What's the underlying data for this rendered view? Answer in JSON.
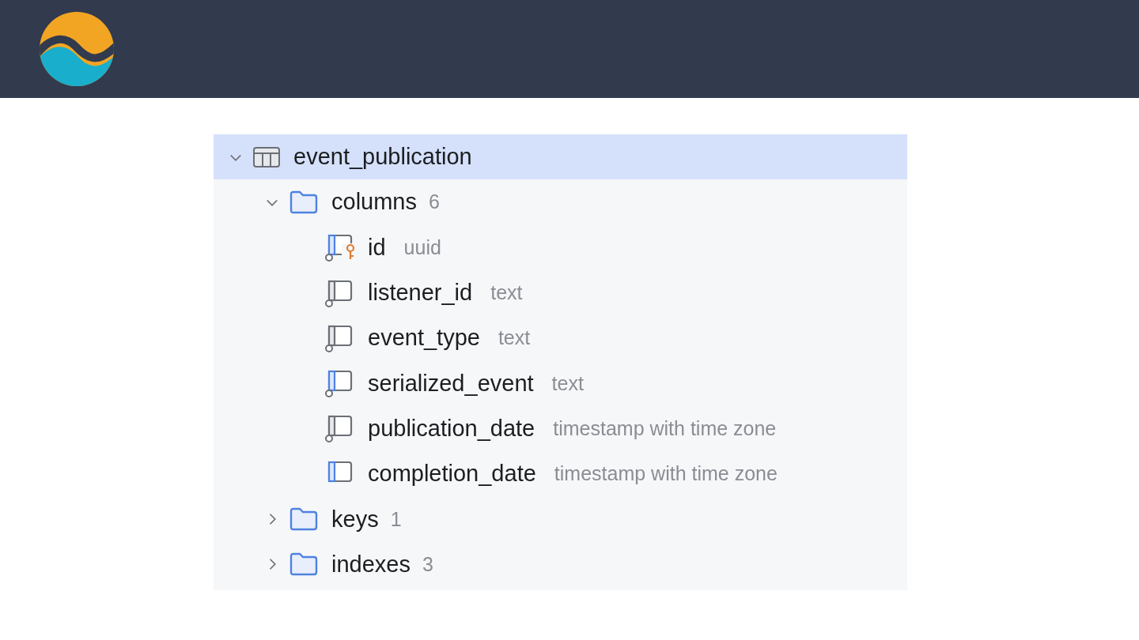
{
  "tree": {
    "label": "event_publication",
    "expanded": true,
    "selected": true,
    "children": [
      {
        "label": "columns",
        "count": "6",
        "expanded": true,
        "children": [
          {
            "name": "id",
            "type": "uuid",
            "accent": true,
            "ring": true,
            "key": true
          },
          {
            "name": "listener_id",
            "type": "text",
            "accent": false,
            "ring": true,
            "key": false
          },
          {
            "name": "event_type",
            "type": "text",
            "accent": false,
            "ring": true,
            "key": false
          },
          {
            "name": "serialized_event",
            "type": "text",
            "accent": true,
            "ring": true,
            "key": false
          },
          {
            "name": "publication_date",
            "type": "timestamp with time zone",
            "accent": false,
            "ring": true,
            "key": false
          },
          {
            "name": "completion_date",
            "type": "timestamp with time zone",
            "accent": true,
            "ring": false,
            "key": false
          }
        ]
      },
      {
        "label": "keys",
        "count": "1",
        "expanded": false
      },
      {
        "label": "indexes",
        "count": "3",
        "expanded": false
      }
    ]
  }
}
